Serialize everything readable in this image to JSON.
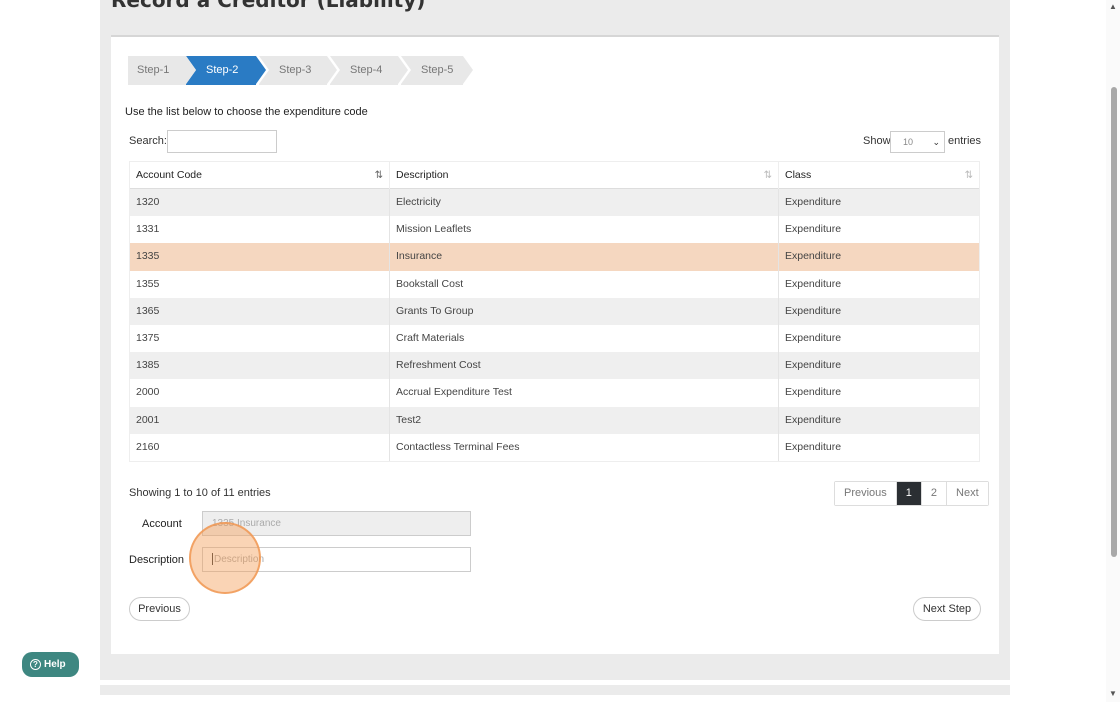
{
  "page": {
    "title": "Record a Creditor (Liability)"
  },
  "wizard": {
    "steps": [
      "Step-1",
      "Step-2",
      "Step-3",
      "Step-4",
      "Step-5"
    ],
    "active_step": "Step-2"
  },
  "instruction": "Use the list below to choose the expenditure code",
  "search": {
    "label": "Search:",
    "value": ""
  },
  "page_size": {
    "show_label": "Show",
    "value": "10",
    "entries_label": "entries"
  },
  "table": {
    "columns": [
      "Account Code",
      "Description",
      "Class"
    ],
    "rows": [
      [
        "1320",
        "Electricity",
        "Expenditure"
      ],
      [
        "1331",
        "Mission Leaflets",
        "Expenditure"
      ],
      [
        "1335",
        "Insurance",
        "Expenditure"
      ],
      [
        "1355",
        "Bookstall Cost",
        "Expenditure"
      ],
      [
        "1365",
        "Grants To Group",
        "Expenditure"
      ],
      [
        "1375",
        "Craft Materials",
        "Expenditure"
      ],
      [
        "1385",
        "Refreshment Cost",
        "Expenditure"
      ],
      [
        "2000",
        "Accrual Expenditure Test",
        "Expenditure"
      ],
      [
        "2001",
        "Test2",
        "Expenditure"
      ],
      [
        "2160",
        "Contactless Terminal Fees",
        "Expenditure"
      ]
    ],
    "selected_row": "1335"
  },
  "table_info": "Showing 1 to 10 of 11 entries",
  "pagination": {
    "previous": "Previous",
    "pages": [
      "1",
      "2"
    ],
    "current": "1",
    "next": "Next"
  },
  "form": {
    "account_label": "Account",
    "account_value": "1335 Insurance",
    "description_label": "Description",
    "description_placeholder": "Description"
  },
  "buttons": {
    "previous": "Previous",
    "next_step": "Next Step"
  },
  "help": {
    "label": "Help"
  },
  "colors": {
    "accent": "#2a7bc4",
    "selected_row": "#f5d7c0",
    "help": "#3e8781",
    "pager_active": "#2b2f33"
  }
}
